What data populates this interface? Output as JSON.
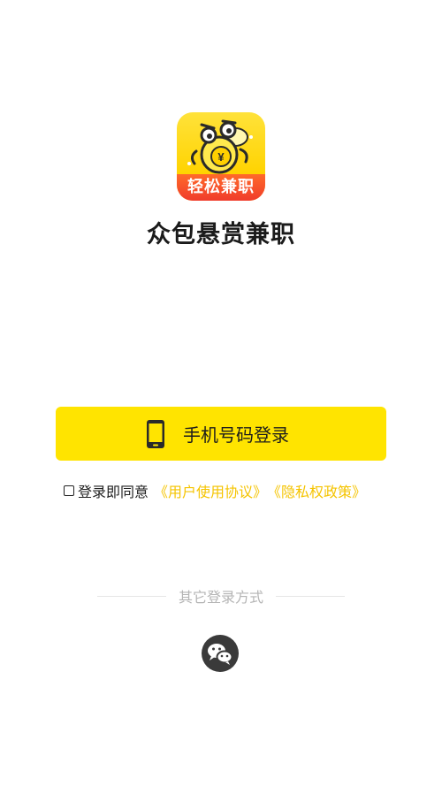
{
  "app": {
    "logo_text": "轻松兼职",
    "name": "众包悬赏兼职"
  },
  "login": {
    "phone_button_label": "手机号码登录",
    "phone_icon": "smartphone-icon"
  },
  "agreement": {
    "checked": false,
    "prefix": "登录即同意",
    "user_agreement": "《用户使用协议》",
    "privacy_policy": "《隐私权政策》"
  },
  "other_login": {
    "label": "其它登录方式",
    "wechat_icon": "wechat-icon"
  },
  "colors": {
    "primary": "#ffe400",
    "link": "#f5c400",
    "logo_ribbon": "#f03c2b",
    "wechat_circle": "#3a3a3a"
  }
}
